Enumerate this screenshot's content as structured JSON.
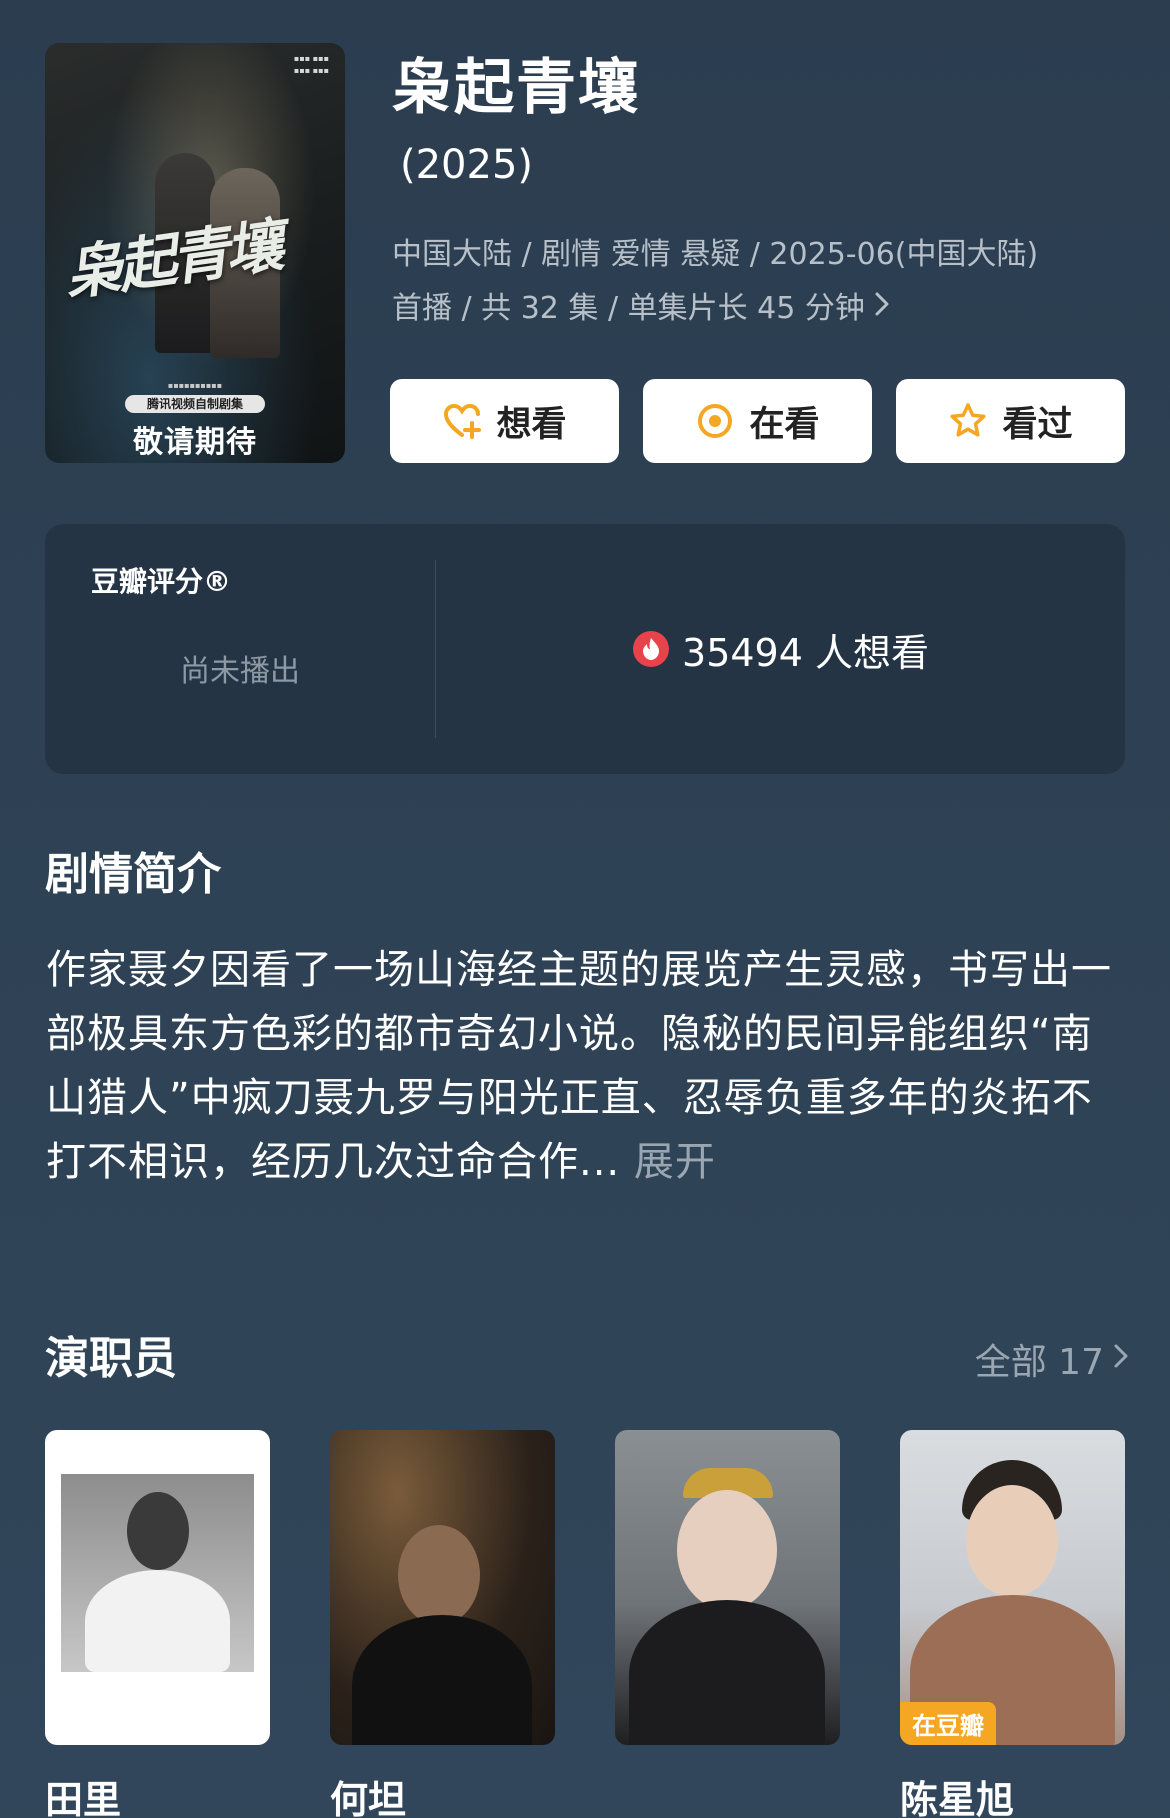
{
  "poster": {
    "calligraphy": "枭起青壤",
    "tag": "腾讯视频自制剧集",
    "cta": "敬请期待"
  },
  "show": {
    "title": "枭起青壤",
    "year": "(2025)",
    "meta_line1": "中国大陆 / 剧情 爱情 悬疑 / 2025-06(中国大陆)",
    "meta_line2": "首播 / 共 32 集 / 单集片长 45 分钟"
  },
  "actions": {
    "want": "想看",
    "watching": "在看",
    "watched": "看过"
  },
  "rating": {
    "label": "豆瓣评分®",
    "status": "尚未播出",
    "wish_count": "35494 人想看"
  },
  "synopsis": {
    "title": "剧情简介",
    "text": "作家聂夕因看了一场山海经主题的展览产生灵感，书写出一部极具东方色彩的都市奇幻小说。隐秘的民间异能组织“南山猎人”中疯刀聂九罗与阳光正直、忍辱负重多年的炎拓不打不相识，经历几次过命合作...",
    "expand_label": "展开"
  },
  "cast": {
    "title": "演职员",
    "see_all": "全部 17",
    "members": [
      {
        "name": "田里"
      },
      {
        "name": "何坦"
      },
      {
        "name": ""
      },
      {
        "name": "陈星旭",
        "badge": "在豆瓣"
      }
    ]
  },
  "colors": {
    "background": "#2e4154",
    "card": "#243444",
    "accent_orange": "#f5a623",
    "flame_red": "#e8424a"
  }
}
